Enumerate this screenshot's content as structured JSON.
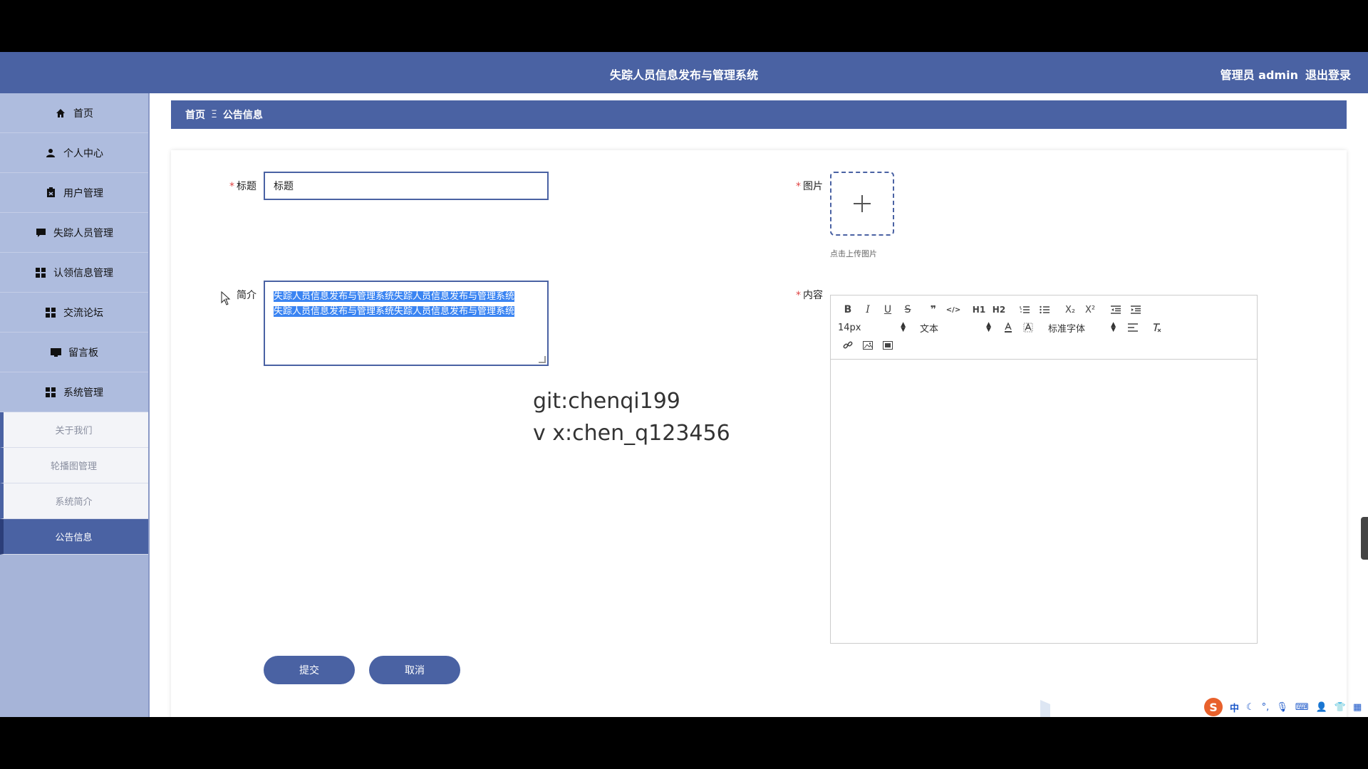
{
  "app": {
    "title": "失踪人员信息发布与管理系统",
    "user_role": "管理员 admin",
    "logout_label": "退出登录"
  },
  "sidebar": {
    "items": [
      {
        "label": "首页",
        "icon": "home-icon"
      },
      {
        "label": "个人中心",
        "icon": "user-icon"
      },
      {
        "label": "用户管理",
        "icon": "clipboard-icon"
      },
      {
        "label": "失踪人员管理",
        "icon": "comment-icon"
      },
      {
        "label": "认领信息管理",
        "icon": "grid-icon"
      },
      {
        "label": "交流论坛",
        "icon": "grid-icon"
      },
      {
        "label": "留言板",
        "icon": "monitor-icon"
      },
      {
        "label": "系统管理",
        "icon": "grid-icon"
      }
    ],
    "sub_items": [
      {
        "label": "关于我们"
      },
      {
        "label": "轮播图管理"
      },
      {
        "label": "系统简介"
      },
      {
        "label": "公告信息",
        "active": true
      }
    ]
  },
  "breadcrumb": {
    "home": "首页",
    "separator": "Ξ",
    "current": "公告信息"
  },
  "form": {
    "title_label": "标题",
    "title_value": "标题",
    "intro_label": "简介",
    "intro_line1": "失踪人员信息发布与管理系统失踪人员信息发布与管理系统",
    "intro_line2": "失踪人员信息发布与管理系统失踪人员信息发布与管理系统",
    "image_label": "图片",
    "upload_hint": "点击上传图片",
    "content_label": "内容",
    "submit_label": "提交",
    "cancel_label": "取消",
    "required_mark": "*"
  },
  "editor": {
    "font_size": "14px",
    "paragraph_format": "文本",
    "font_family": "标准字体",
    "toolbar_row1": [
      "B",
      "I",
      "U",
      "S",
      "❞",
      "</>",
      "H1",
      "H2",
      "ol",
      "ul",
      "X₂",
      "X²",
      "outdent",
      "indent"
    ]
  },
  "watermark": {
    "line1": "git:chenqi199",
    "line2": "v x:chen_q123456"
  },
  "tray": {
    "ime": "中"
  },
  "colors": {
    "primary": "#4a62a3",
    "sidebar_bg": "#aebcde",
    "selection": "#3a84f2",
    "required": "#e04444"
  }
}
